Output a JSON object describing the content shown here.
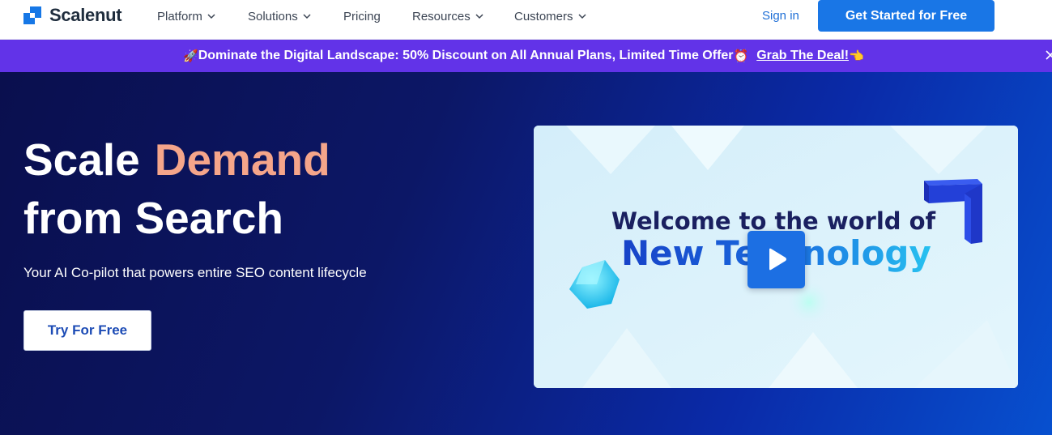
{
  "nav": {
    "logo_text": "Scalenut",
    "items": [
      {
        "label": "Platform",
        "has_dropdown": true
      },
      {
        "label": "Solutions",
        "has_dropdown": true
      },
      {
        "label": "Pricing",
        "has_dropdown": false
      },
      {
        "label": "Resources",
        "has_dropdown": true
      },
      {
        "label": "Customers",
        "has_dropdown": true
      }
    ],
    "sign_in": "Sign in",
    "cta": "Get Started for Free"
  },
  "promo": {
    "rocket_emoji": "🚀",
    "text": "Dominate the Digital Landscape: 50% Discount on All Annual Plans, Limited Time Offer",
    "clock_emoji": "⏰",
    "link": "Grab The Deal!",
    "hand_emoji": "👈"
  },
  "hero": {
    "title_part1": "Scale",
    "title_accent": "Demand",
    "title_part2": "from Search",
    "subtitle": "Your AI Co-pilot that powers entire SEO content lifecycle",
    "button": "Try For Free"
  },
  "video": {
    "headline_line1": "Welcome to the world of",
    "headline_line2": "New Technology"
  },
  "colors": {
    "brand_blue": "#1976e6",
    "promo_purple": "#6233e8",
    "accent_salmon": "#f5a58a",
    "hero_dark": "#0a0f4e"
  },
  "icons": [
    "scalenut-logo-icon",
    "chevron-down-icon",
    "close-icon",
    "play-icon"
  ]
}
